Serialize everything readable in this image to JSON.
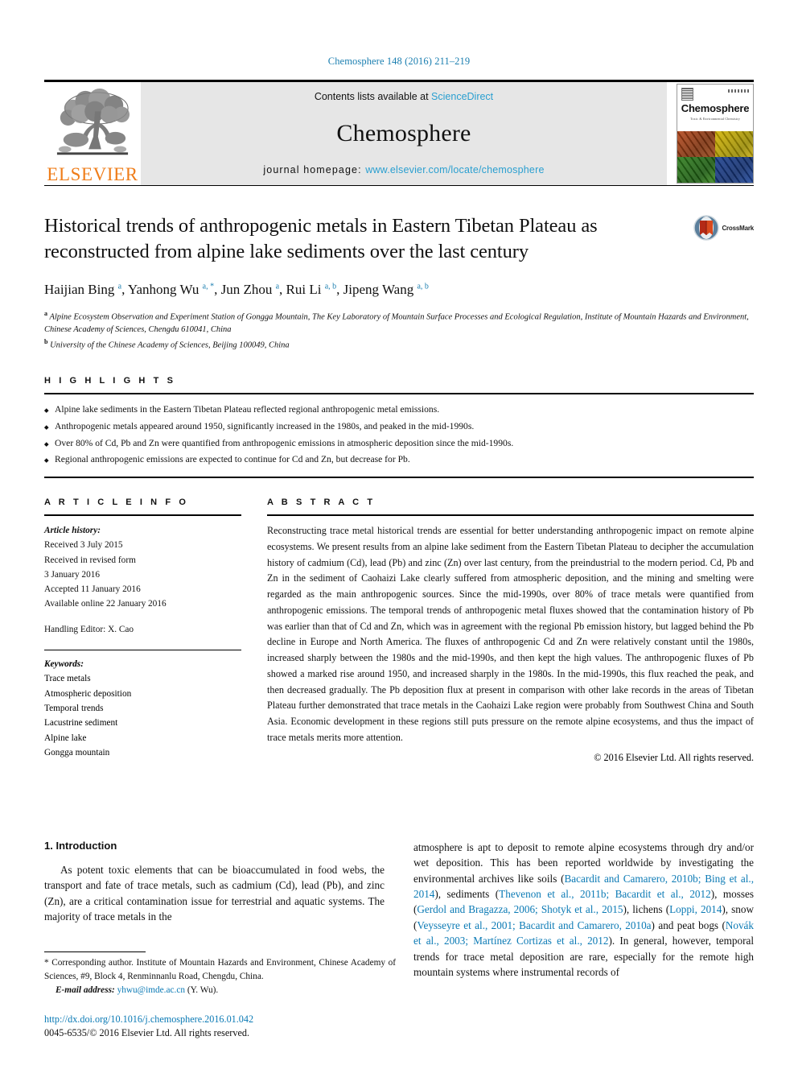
{
  "journal_ref": "Chemosphere 148 (2016) 211–219",
  "masthead": {
    "publisher_name": "ELSEVIER",
    "contents_prefix": "Contents lists available at ",
    "sciencedirect": "ScienceDirect",
    "journal_title": "Chemosphere",
    "homepage_prefix": "journal homepage: ",
    "homepage_url": "www.elsevier.com/locate/chemosphere",
    "cover_title": "Chemosphere",
    "cover_subtitle": "Toxic & Environmental Chemistry"
  },
  "article": {
    "title": "Historical trends of anthropogenic metals in Eastern Tibetan Plateau as reconstructed from alpine lake sediments over the last century",
    "crossmark_label": "CrossMark",
    "authors_html": "Haijian Bing <sup>a</sup>, Yanhong Wu <sup>a, *</sup>, Jun Zhou <sup>a</sup>, Rui Li <sup>a, b</sup>, Jipeng Wang <sup>a, b</sup>",
    "affiliation_a": "Alpine Ecosystem Observation and Experiment Station of Gongga Mountain, The Key Laboratory of Mountain Surface Processes and Ecological Regulation, Institute of Mountain Hazards and Environment, Chinese Academy of Sciences, Chengdu 610041, China",
    "affiliation_b": "University of the Chinese Academy of Sciences, Beijing 100049, China"
  },
  "highlights": {
    "heading": "H I G H L I G H T S",
    "items": [
      "Alpine lake sediments in the Eastern Tibetan Plateau reflected regional anthropogenic metal emissions.",
      "Anthropogenic metals appeared around 1950, significantly increased in the 1980s, and peaked in the mid-1990s.",
      "Over 80% of Cd, Pb and Zn were quantified from anthropogenic emissions in atmospheric deposition since the mid-1990s.",
      "Regional anthropogenic emissions are expected to continue for Cd and Zn, but decrease for Pb."
    ]
  },
  "article_info": {
    "heading": "A R T I C L E  I N F O",
    "history_label": "Article history:",
    "history_lines": [
      "Received 3 July 2015",
      "Received in revised form",
      "3 January 2016",
      "Accepted 11 January 2016",
      "Available online 22 January 2016"
    ],
    "handling_editor": "Handling Editor: X. Cao",
    "keywords_label": "Keywords:",
    "keywords": [
      "Trace metals",
      "Atmospheric deposition",
      "Temporal trends",
      "Lacustrine sediment",
      "Alpine lake",
      "Gongga mountain"
    ]
  },
  "abstract": {
    "heading": "A B S T R A C T",
    "text": "Reconstructing trace metal historical trends are essential for better understanding anthropogenic impact on remote alpine ecosystems. We present results from an alpine lake sediment from the Eastern Tibetan Plateau to decipher the accumulation history of cadmium (Cd), lead (Pb) and zinc (Zn) over last century, from the preindustrial to the modern period. Cd, Pb and Zn in the sediment of Caohaizi Lake clearly suffered from atmospheric deposition, and the mining and smelting were regarded as the main anthropogenic sources. Since the mid-1990s, over 80% of trace metals were quantified from anthropogenic emissions. The temporal trends of anthropogenic metal fluxes showed that the contamination history of Pb was earlier than that of Cd and Zn, which was in agreement with the regional Pb emission history, but lagged behind the Pb decline in Europe and North America. The fluxes of anthropogenic Cd and Zn were relatively constant until the 1980s, increased sharply between the 1980s and the mid-1990s, and then kept the high values. The anthropogenic fluxes of Pb showed a marked rise around 1950, and increased sharply in the 1980s. In the mid-1990s, this flux reached the peak, and then decreased gradually. The Pb deposition flux at present in comparison with other lake records in the areas of Tibetan Plateau further demonstrated that trace metals in the Caohaizi Lake region were probably from Southwest China and South Asia. Economic development in these regions still puts pressure on the remote alpine ecosystems, and thus the impact of trace metals merits more attention.",
    "copyright": "© 2016 Elsevier Ltd. All rights reserved."
  },
  "introduction": {
    "number_title": "1. Introduction",
    "left_paragraph": "As potent toxic elements that can be bioaccumulated in food webs, the transport and fate of trace metals, such as cadmium (Cd), lead (Pb), and zinc (Zn), are a critical contamination issue for terrestrial and aquatic systems. The majority of trace metals in the"
  },
  "right_column": {
    "segments": [
      {
        "t": "atmosphere is apt to deposit to remote alpine ecosystems through dry and/or wet deposition. This has been reported worldwide by investigating the environmental archives like soils (",
        "ref": false
      },
      {
        "t": "Bacardit and Camarero, 2010b; Bing et al., 2014",
        "ref": true
      },
      {
        "t": "), sediments (",
        "ref": false
      },
      {
        "t": "Thevenon et al., 2011b; Bacardit et al., 2012",
        "ref": true
      },
      {
        "t": "), mosses (",
        "ref": false
      },
      {
        "t": "Gerdol and Bragazza, 2006; Shotyk et al., 2015",
        "ref": true
      },
      {
        "t": "), lichens (",
        "ref": false
      },
      {
        "t": "Loppi, 2014",
        "ref": true
      },
      {
        "t": "), snow (",
        "ref": false
      },
      {
        "t": "Veysseyre et al., 2001; Bacardit and Camarero, 2010a",
        "ref": true
      },
      {
        "t": ") and peat bogs (",
        "ref": false
      },
      {
        "t": "Novák et al., 2003; Martínez Cortizas et al., 2012",
        "ref": true
      },
      {
        "t": "). In general, however, temporal trends for trace metal deposition are rare, especially for the remote high mountain systems where instrumental records of",
        "ref": false
      }
    ]
  },
  "footer": {
    "corresponding_marker": "*",
    "corresponding_text": "Corresponding author. Institute of Mountain Hazards and Environment, Chinese Academy of Sciences, #9, Block 4, Renminnanlu Road, Chengdu, China.",
    "email_label": "E-mail address:",
    "email": "yhwu@imde.ac.cn",
    "email_suffix": "(Y. Wu).",
    "doi": "http://dx.doi.org/10.1016/j.chemosphere.2016.01.042",
    "issn_line": "0045-6535/© 2016 Elsevier Ltd. All rights reserved."
  }
}
